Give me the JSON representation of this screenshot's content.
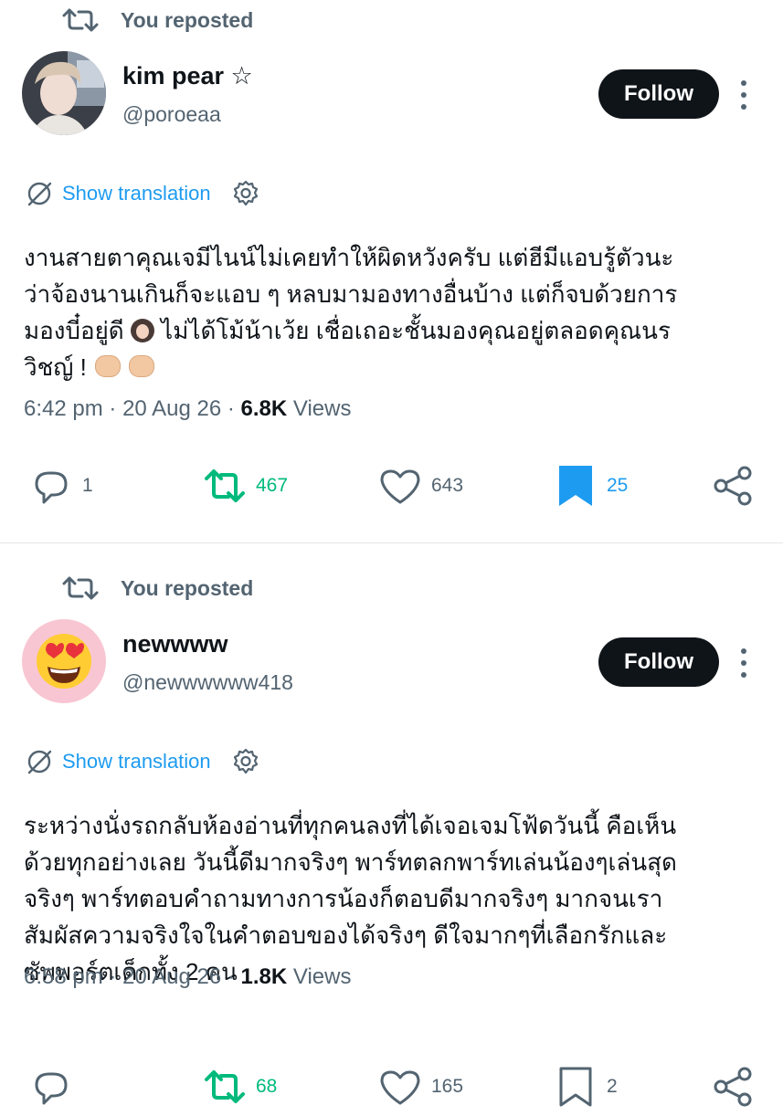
{
  "posts": [
    {
      "repost_label": "You reposted",
      "name": "kim pear ☆",
      "handle": "@poroeaa",
      "follow_label": "Follow",
      "translate_label": "Show translation",
      "body_lines": [
        "งานสายตาคุณเจมีไนน์ไม่เคยทำให้ผิดหวังครับ แต่ฮีมีแอบรู้ตัวนะ",
        "ว่าจ้องนานเกินก็จะแอบ ๆ หลบมามองทางอื่นบ้าง แต่ก็จบด้วยการ",
        "มองบี๋อยู่ดี",
        "ไม่ได้โม้น้าเว้ย เชื่อเถอะชั้นมองคุณอยู่ตลอดคุณนร",
        "วิชญ์ !"
      ],
      "time": "6:42 pm",
      "date": "20 Aug 26",
      "views_count": "6.8K",
      "views_label": "Views",
      "replies": "1",
      "reposts": "467",
      "likes": "643",
      "bookmarks": "25"
    },
    {
      "repost_label": "You reposted",
      "name": "newwww",
      "handle": "@newwwwww418",
      "follow_label": "Follow",
      "translate_label": "Show translation",
      "body_lines": [
        "ระหว่างนั่งรถกลับห้องอ่านที่ทุกคนลงที่ได้เจอเจมโฟ้ดวันนี้ คือเห็น",
        "ด้วยทุกอย่างเลย วันนี้ดีมากจริงๆ พาร์ทตลกพาร์ทเล่นน้องๆเล่นสุด",
        "จริงๆ พาร์ทตอบคำถามทางการน้องก็ตอบดีมากจริงๆ มากจนเรา",
        "สัมผัสความจริงใจในคำตอบของได้จริงๆ ดีใจมากๆที่เลือกรักและ",
        "ซัพพอร์ตเด็กทั้ง 2 คน"
      ],
      "time": "6:58 pm",
      "date": "20 Aug 26",
      "views_count": "1.8K",
      "views_label": "Views",
      "replies": "",
      "reposts": "68",
      "likes": "165",
      "bookmarks": "2"
    }
  ],
  "separator": "·",
  "icons": [
    "repost-icon",
    "globe-slash-icon",
    "gear-icon",
    "more-icon",
    "reply-icon",
    "like-icon",
    "bookmark-icon",
    "share-icon"
  ],
  "colors": {
    "accent": "#1d9bf0",
    "repost_green": "#00ba7c",
    "text_secondary": "#536471",
    "button_dark": "#0f1419"
  }
}
